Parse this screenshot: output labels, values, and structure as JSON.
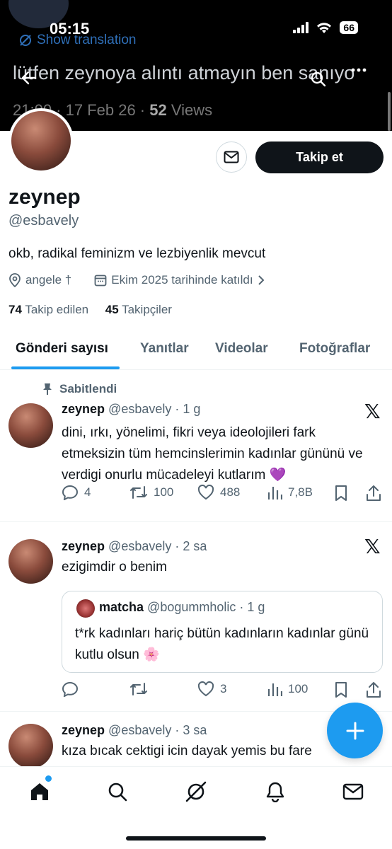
{
  "status_bar": {
    "time": "05:15",
    "battery": "66"
  },
  "banner": {
    "show_translation": "Show translation",
    "tweet_text": "lütfen zeynoya alıntı atmayın ben sanıyo",
    "timestamp": "21:00 · 17 Feb 26 · ",
    "views_count": "52",
    "views_label": " Views"
  },
  "profile": {
    "display_name": "zeynep",
    "handle": "@esbavely",
    "bio": "okb, radikal feminizm ve lezbiyenlik mevcut",
    "location": "angele †",
    "joined": "Ekim 2025 tarihinde katıldı",
    "following_count": "74",
    "following_label": "Takip edilen",
    "followers_count": "45",
    "followers_label": "Takipçiler",
    "follow_button": "Takip et"
  },
  "tabs": [
    "Gönderi sayısı",
    "Yanıtlar",
    "Videolar",
    "Fotoğraflar"
  ],
  "pinned_label": "Sabitlendi",
  "tweets": [
    {
      "name": "zeynep",
      "meta": "@esbavely · 1 g",
      "text": "dini, ırkı, yönelimi, fikri veya ideolojileri fark etmeksizin tüm hemcinslerimin kadınlar gününü ve verdigi onurlu mücadeleyi kutlarım 💜",
      "replies": "4",
      "retweets": "100",
      "likes": "488",
      "views": "7,8B"
    },
    {
      "name": "zeynep",
      "meta": "@esbavely · 2 sa",
      "text": "ezigimdir o benim",
      "quote": {
        "name": "matcha",
        "meta": "@bogummholic · 1 g",
        "text": "t*rk kadınları hariç bütün kadınların kadınlar günü kutlu olsun 🌸"
      },
      "replies": "",
      "retweets": "",
      "likes": "3",
      "views": "100"
    },
    {
      "name": "zeynep",
      "meta": "@esbavely · 3 sa",
      "text": "kıza bıcak cektigi icin dayak yemis bu fare"
    }
  ],
  "colors": {
    "accent": "#1d9bf0",
    "text": "#0f1419",
    "muted": "#536471"
  }
}
